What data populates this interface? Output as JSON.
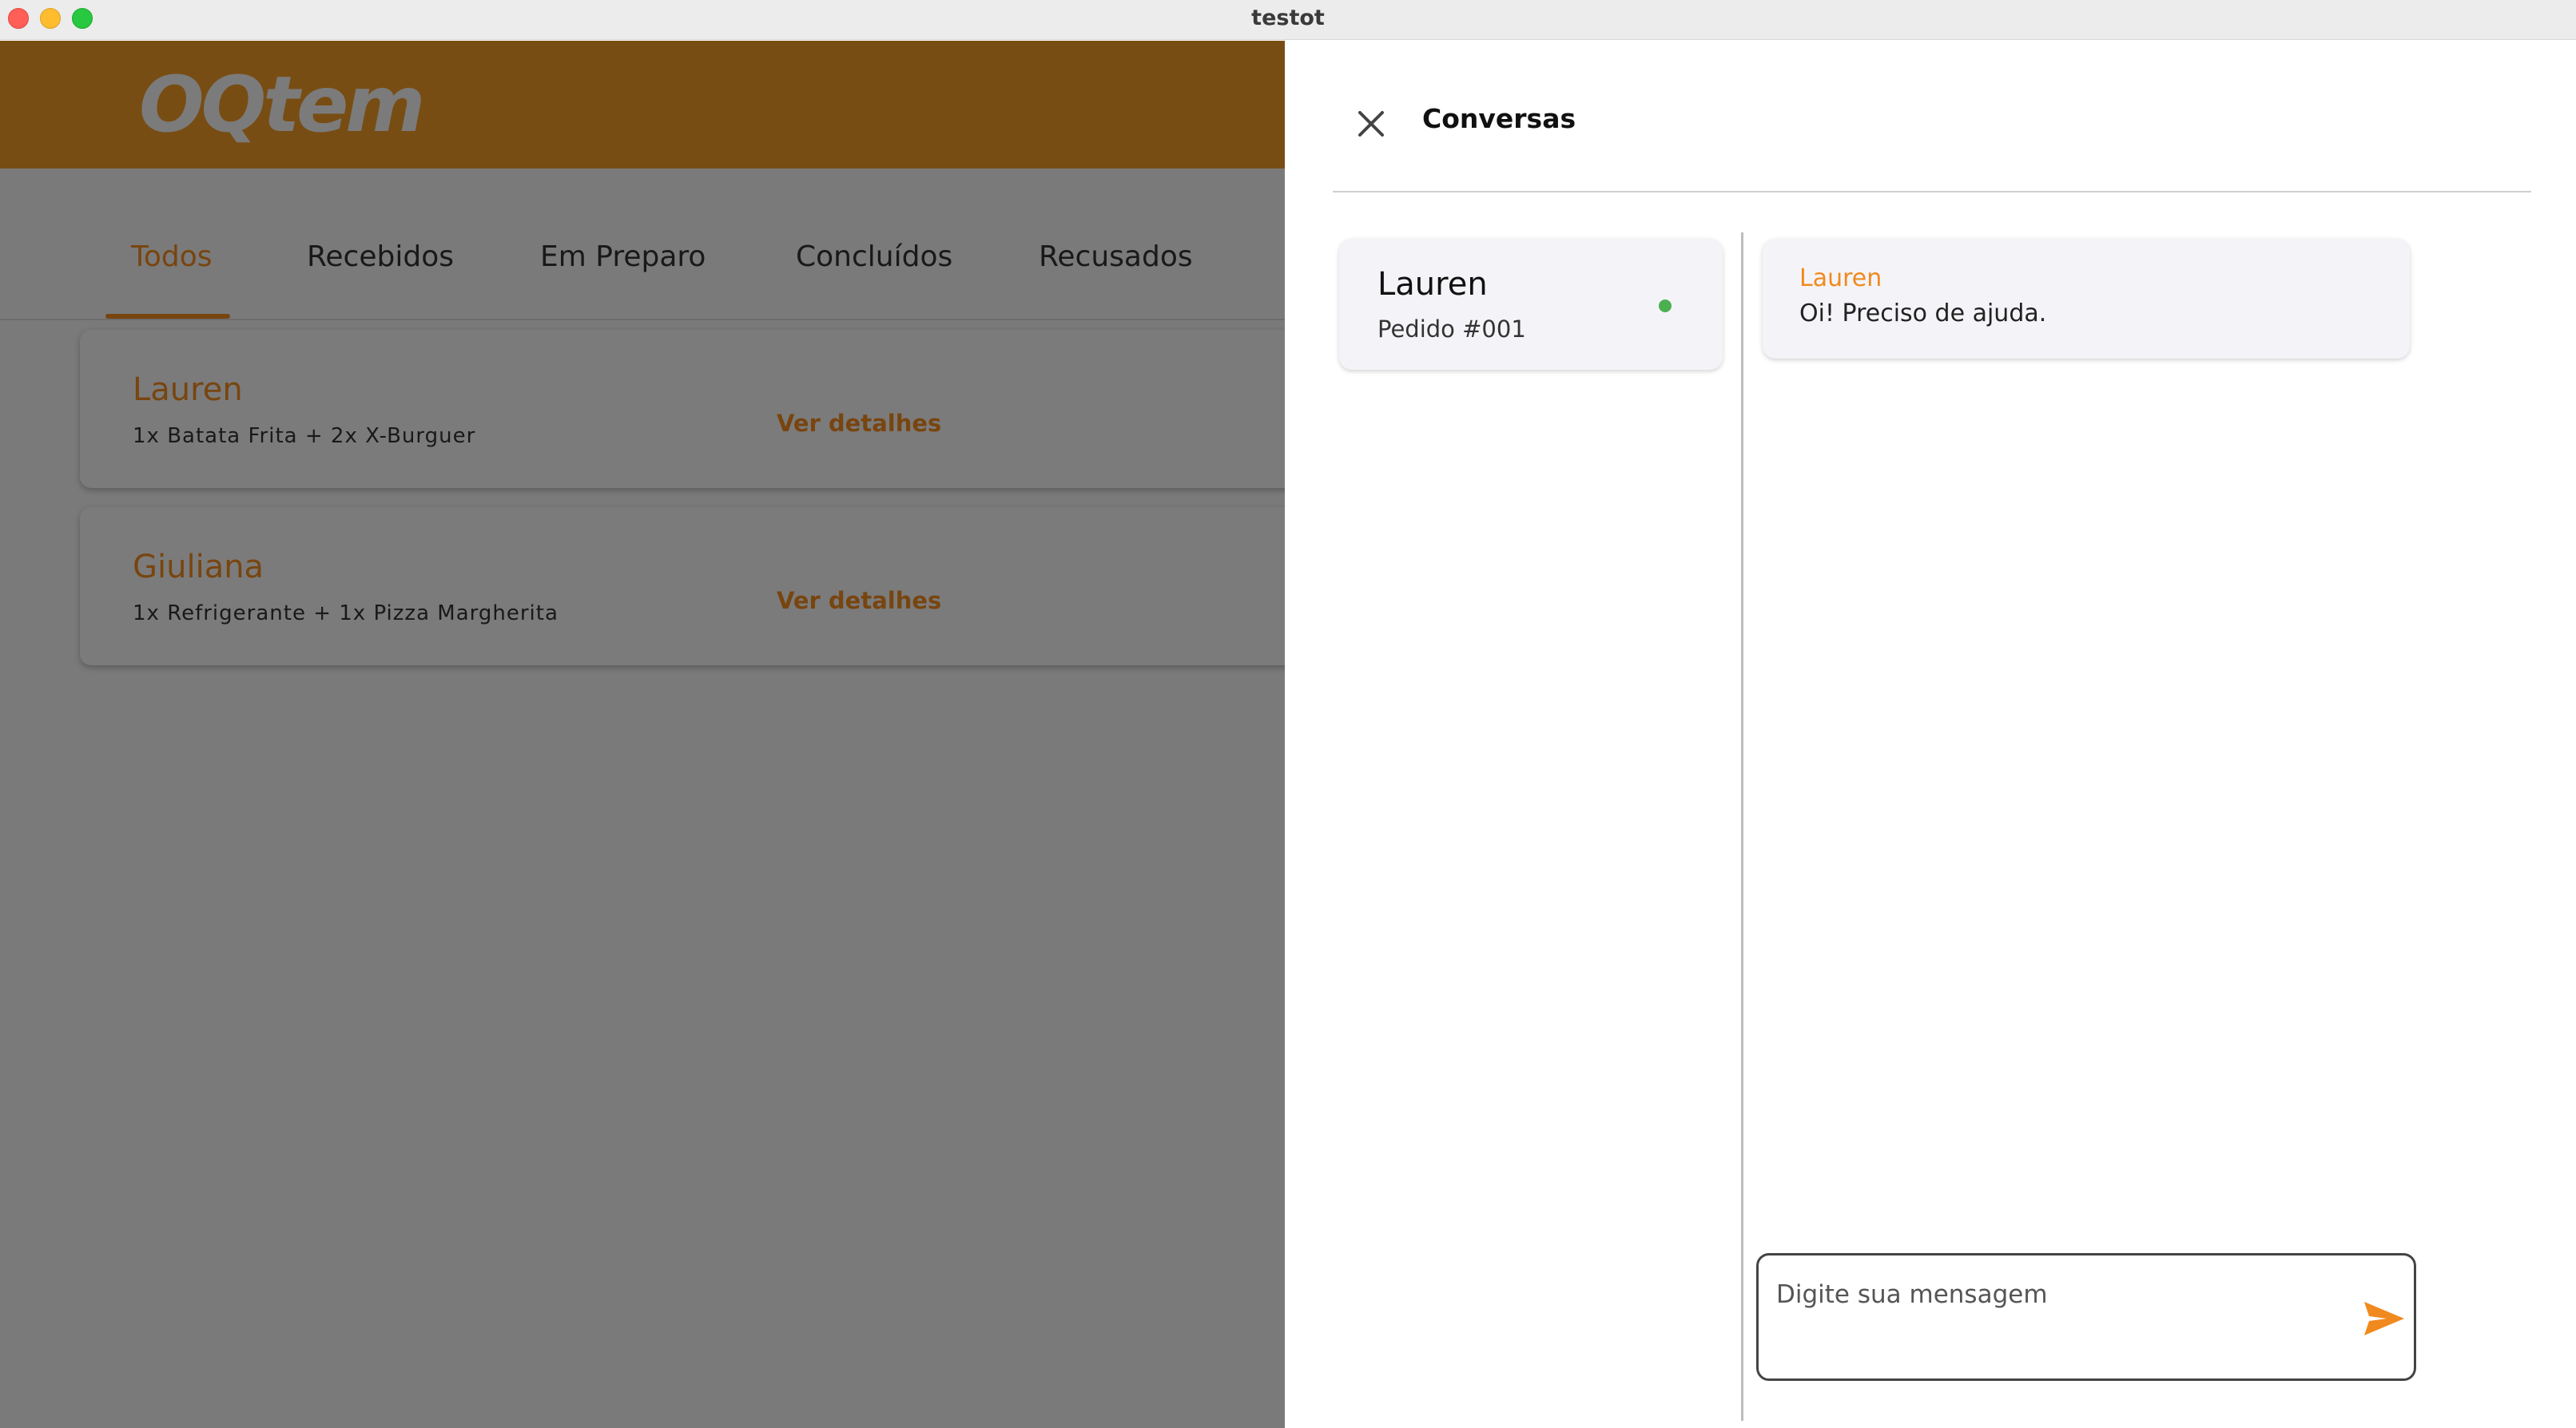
{
  "window": {
    "title": "testot"
  },
  "app": {
    "logo": "OQtem",
    "tabs": [
      {
        "label": "Todos",
        "active": true
      },
      {
        "label": "Recebidos",
        "active": false
      },
      {
        "label": "Em Preparo",
        "active": false
      },
      {
        "label": "Concluídos",
        "active": false
      },
      {
        "label": "Recusados",
        "active": false
      }
    ],
    "orders": [
      {
        "name": "Lauren",
        "items": "1x Batata Frita + 2x X-Burguer",
        "link": "Ver detalhes"
      },
      {
        "name": "Giuliana",
        "items": "1x Refrigerante + 1x Pizza Margherita",
        "link": "Ver detalhes"
      }
    ]
  },
  "chat": {
    "title": "Conversas",
    "close_icon": "close-icon",
    "conversations": [
      {
        "name": "Lauren",
        "subtitle": "Pedido #001",
        "online": true
      }
    ],
    "messages": [
      {
        "author": "Lauren",
        "text": "Oi! Preciso de ajuda."
      }
    ],
    "input": {
      "placeholder": "Digite sua mensagem",
      "value": ""
    },
    "send_icon": "send-icon"
  },
  "colors": {
    "accent": "#f08a1e",
    "header": "#f09a28",
    "online": "#4caf50"
  }
}
